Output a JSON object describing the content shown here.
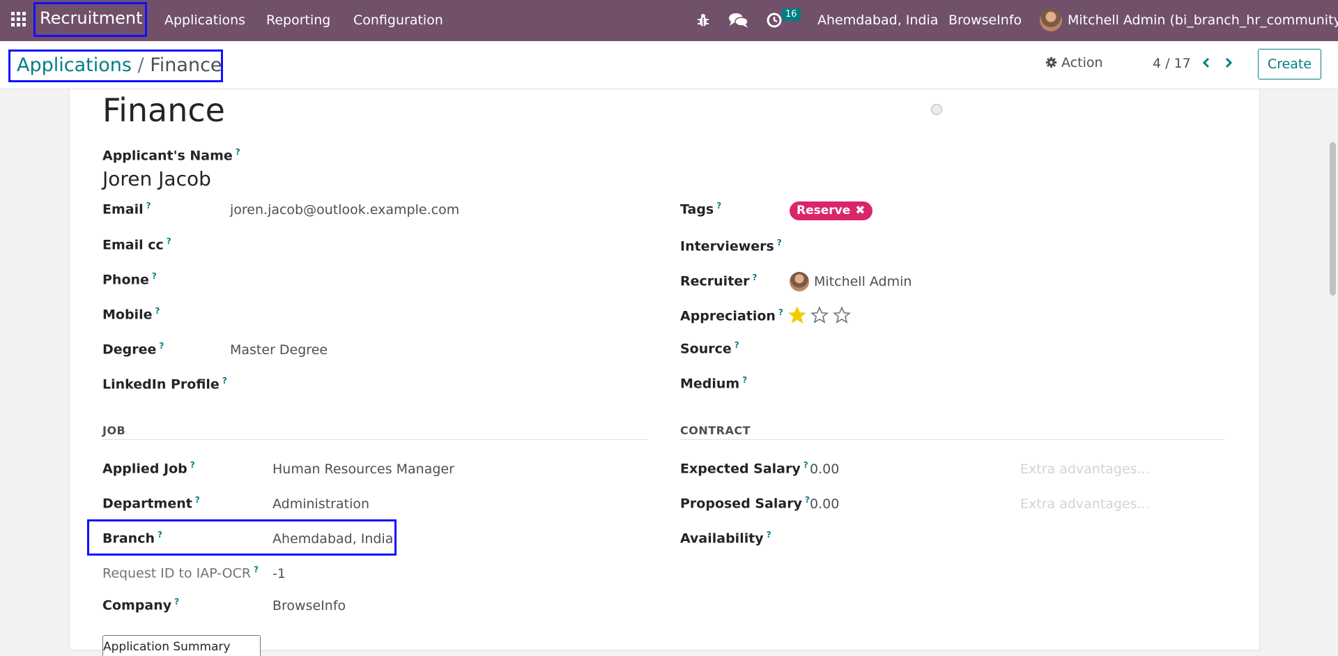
{
  "navbar": {
    "app_name": "Recruitment",
    "menus": [
      "Applications",
      "Reporting",
      "Configuration"
    ],
    "activity_count": "16",
    "branch": "Ahemdabad, India",
    "company": "BrowseInfo",
    "user": "Mitchell Admin (bi_branch_hr_community)",
    "icons": [
      "apps-grid-icon",
      "bug-icon",
      "chat-icon",
      "clock-icon"
    ]
  },
  "breadcrumb": {
    "parent": "Applications",
    "separator": "/",
    "current": "Finance"
  },
  "control": {
    "action_label": "Action",
    "pager": "4 / 17",
    "create_label": "Create"
  },
  "record": {
    "title": "Finance",
    "applicant_name_label": "Applicant's Name",
    "applicant_name": "Joren Jacob",
    "help_mark": "?"
  },
  "left_fields": [
    {
      "label": "Email",
      "value": "joren.jacob@outlook.example.com"
    },
    {
      "label": "Email cc",
      "value": ""
    },
    {
      "label": "Phone",
      "value": ""
    },
    {
      "label": "Mobile",
      "value": ""
    },
    {
      "label": "Degree",
      "value": "Master Degree"
    },
    {
      "label": "LinkedIn Profile",
      "value": ""
    }
  ],
  "right_fields": {
    "tags_label": "Tags",
    "tag": "Reserve",
    "interviewers_label": "Interviewers",
    "recruiter_label": "Recruiter",
    "recruiter": "Mitchell Admin",
    "appreciation_label": "Appreciation",
    "appreciation_stars": 1,
    "appreciation_max": 3,
    "source_label": "Source",
    "medium_label": "Medium"
  },
  "job_section": {
    "heading": "JOB",
    "fields": [
      {
        "label": "Applied Job",
        "value": "Human Resources Manager"
      },
      {
        "label": "Department",
        "value": "Administration"
      },
      {
        "label": "Branch",
        "value": "Ahemdabad, India"
      },
      {
        "label": "Request ID to IAP-OCR",
        "value": "-1"
      },
      {
        "label": "Company",
        "value": "BrowseInfo"
      }
    ]
  },
  "contract_section": {
    "heading": "CONTRACT",
    "expected_salary_label": "Expected Salary",
    "expected_salary": "0.00",
    "proposed_salary_label": "Proposed Salary",
    "proposed_salary": "0.00",
    "extra_placeholder": "Extra advantages...",
    "availability_label": "Availability"
  },
  "summary_tab": "Application Summary",
  "colors": {
    "navbar": "#71506a",
    "accent": "#017e84",
    "tag": "#d9266a",
    "star": "#f3cc00",
    "highlight_box": "#1010ff"
  }
}
